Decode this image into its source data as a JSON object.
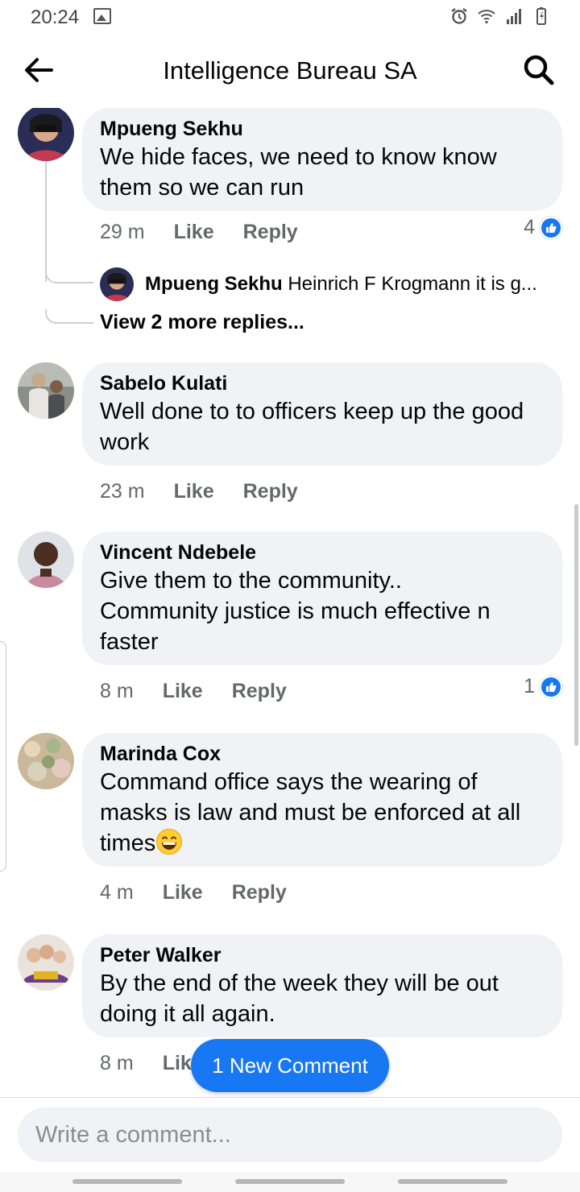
{
  "status": {
    "time": "20:24"
  },
  "header": {
    "title": "Intelligence Bureau SA"
  },
  "comments": [
    {
      "author": "Mpueng Sekhu",
      "text": "We hide faces, we need to know know\nthem so we can run",
      "time": "29 m",
      "like_label": "Like",
      "reply_label": "Reply",
      "reaction_count": "4"
    },
    {
      "author": "Sabelo Kulati",
      "text": "Well done to to officers keep up the good\nwork",
      "time": "23 m",
      "like_label": "Like",
      "reply_label": "Reply"
    },
    {
      "author": "Vincent Ndebele",
      "text": "Give them to the community..\nCommunity justice is much effective n\nfaster",
      "time": "8 m",
      "like_label": "Like",
      "reply_label": "Reply",
      "reaction_count": "1"
    },
    {
      "author": "Marinda Cox",
      "text": "Command office says the wearing of\nmasks is law and must be enforced at all\ntimes",
      "time": "4 m",
      "like_label": "Like",
      "reply_label": "Reply"
    },
    {
      "author": "Peter Walker",
      "text": "By the end of the week they will be out\ndoing it all again.",
      "time": "8 m",
      "like_label": "Lik",
      "reply_label": ""
    }
  ],
  "reply_preview": {
    "author": "Mpueng Sekhu",
    "text": "Heinrich F Krogmann it is g..."
  },
  "view_more_label": "View 2 more replies...",
  "new_comment_label": "1 New Comment",
  "composer": {
    "placeholder": "Write a comment..."
  },
  "colors": {
    "accent": "#1877f2",
    "bubble": "#f0f2f5",
    "secondary_text": "#65676b"
  }
}
